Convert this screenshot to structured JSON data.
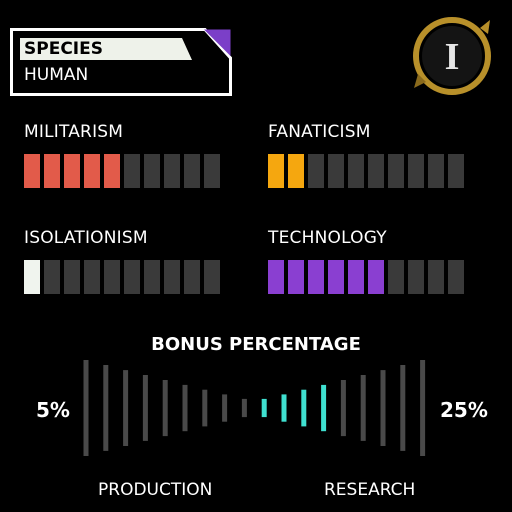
{
  "species": {
    "label": "SPECIES",
    "value": "HUMAN",
    "accent_color": "#7b3fc8"
  },
  "emblem": {
    "icon": "roman-numeral-one-emblem-icon",
    "numeral": "I",
    "color": "#b8902a"
  },
  "stats": [
    {
      "label": "MILITARISM",
      "filled": 5,
      "total": 10,
      "color": "#e25b4a"
    },
    {
      "label": "FANATICISM",
      "filled": 2,
      "total": 10,
      "color": "#f5a70f"
    },
    {
      "label": "ISOLATIONISM",
      "filled": 1,
      "total": 10,
      "color": "#f0f4ee"
    },
    {
      "label": "TECHNOLOGY",
      "filled": 6,
      "total": 10,
      "color": "#8a3fd1"
    }
  ],
  "bonus": {
    "title": "BONUS PERCENTAGE",
    "left_value": "5%",
    "right_value": "25%",
    "left_label": "PRODUCTION",
    "right_label": "RESEARCH",
    "total_ticks": 18,
    "active_ticks": [
      9,
      10,
      11,
      12
    ],
    "active_color": "#3fe0d0",
    "inactive_color": "#4a4a4a"
  }
}
